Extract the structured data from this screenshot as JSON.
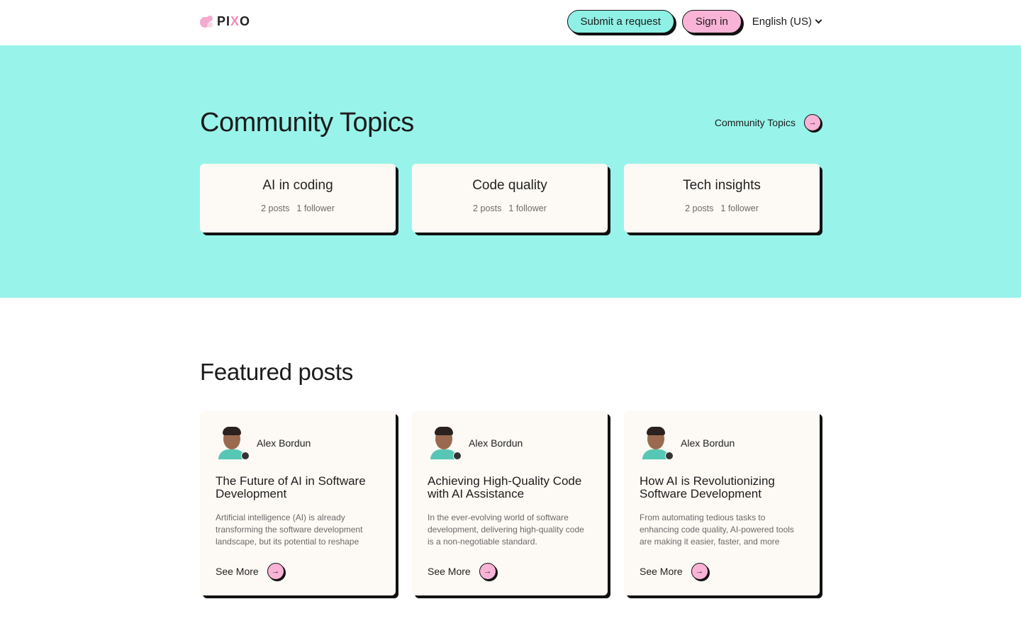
{
  "header": {
    "logo_text_a": "PI",
    "logo_text_x": "X",
    "logo_text_b": "O",
    "submit_label": "Submit a request",
    "signin_label": "Sign in",
    "language": "English (US)"
  },
  "topics": {
    "title": "Community Topics",
    "link_label": "Community Topics",
    "items": [
      {
        "title": "AI in coding",
        "posts": "2 posts",
        "followers": "1 follower"
      },
      {
        "title": "Code quality",
        "posts": "2 posts",
        "followers": "1 follower"
      },
      {
        "title": "Tech insights",
        "posts": "2 posts",
        "followers": "1 follower"
      }
    ]
  },
  "featured": {
    "title": "Featured posts",
    "see_more_label": "See More",
    "posts": [
      {
        "author": "Alex Bordun",
        "title": "The Future of AI in Software Development",
        "excerpt": "Artificial intelligence (AI) is already transforming the software development landscape, but its potential to reshape"
      },
      {
        "author": "Alex Bordun",
        "title": "Achieving High-Quality Code with AI Assistance",
        "excerpt": "In the ever-evolving world of software development, delivering high-quality code is a non-negotiable standard."
      },
      {
        "author": "Alex Bordun",
        "title": "How AI is Revolutionizing Software Development",
        "excerpt": "From automating tedious tasks to enhancing code quality, AI-powered tools are making it easier, faster, and more"
      }
    ]
  },
  "colors": {
    "teal": "#98f4ea",
    "pink": "#f9b3d6",
    "card": "#fdf9f4"
  },
  "icons": {
    "arrow": "arrow-right-icon",
    "chevron": "chevron-down-icon"
  }
}
